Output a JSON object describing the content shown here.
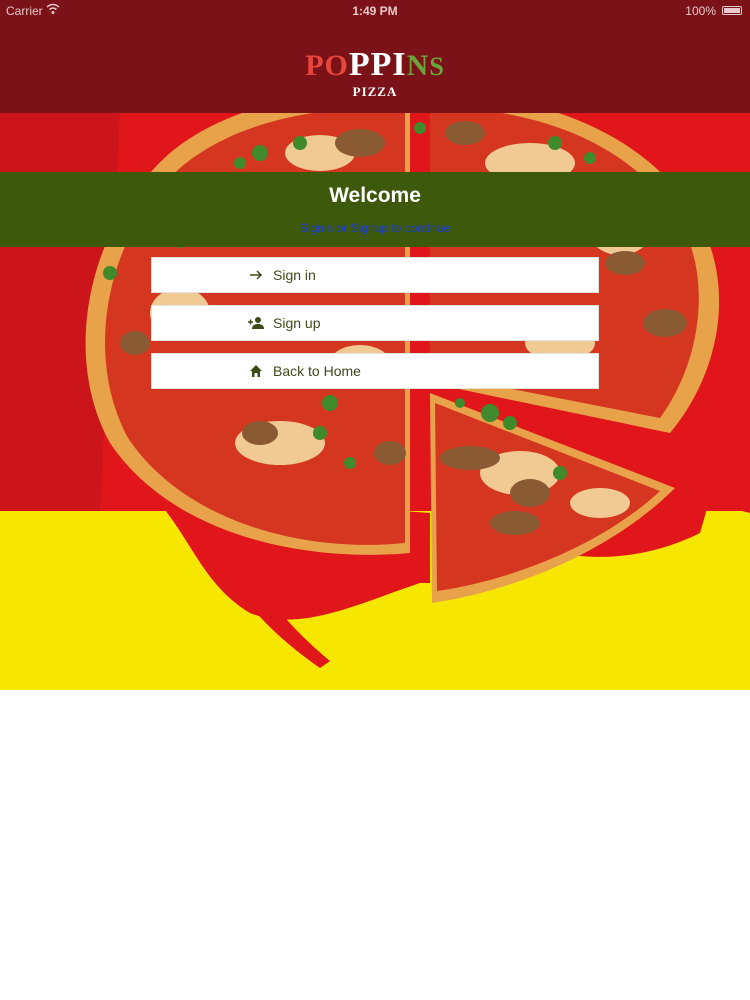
{
  "status_bar": {
    "carrier": "Carrier",
    "time": "1:49 PM",
    "battery": "100%"
  },
  "brand": {
    "logo_word": "POPPINS",
    "logo_sub": "PIZZA"
  },
  "welcome": {
    "title": "Welcome",
    "subtitle": "Signin or Signup to continue"
  },
  "actions": [
    {
      "label": "Sign in",
      "icon": "arrow-right-icon"
    },
    {
      "label": "Sign up",
      "icon": "person-add-icon"
    },
    {
      "label": "Back to Home",
      "icon": "home-icon"
    }
  ],
  "colors": {
    "header": "#7a1218",
    "welcome_band": "#3d5a0c",
    "subtitle_text": "#1b3ad6",
    "button_text": "#3d4a1a",
    "hero_red": "#e0161b",
    "hero_yellow": "#f7e600"
  }
}
